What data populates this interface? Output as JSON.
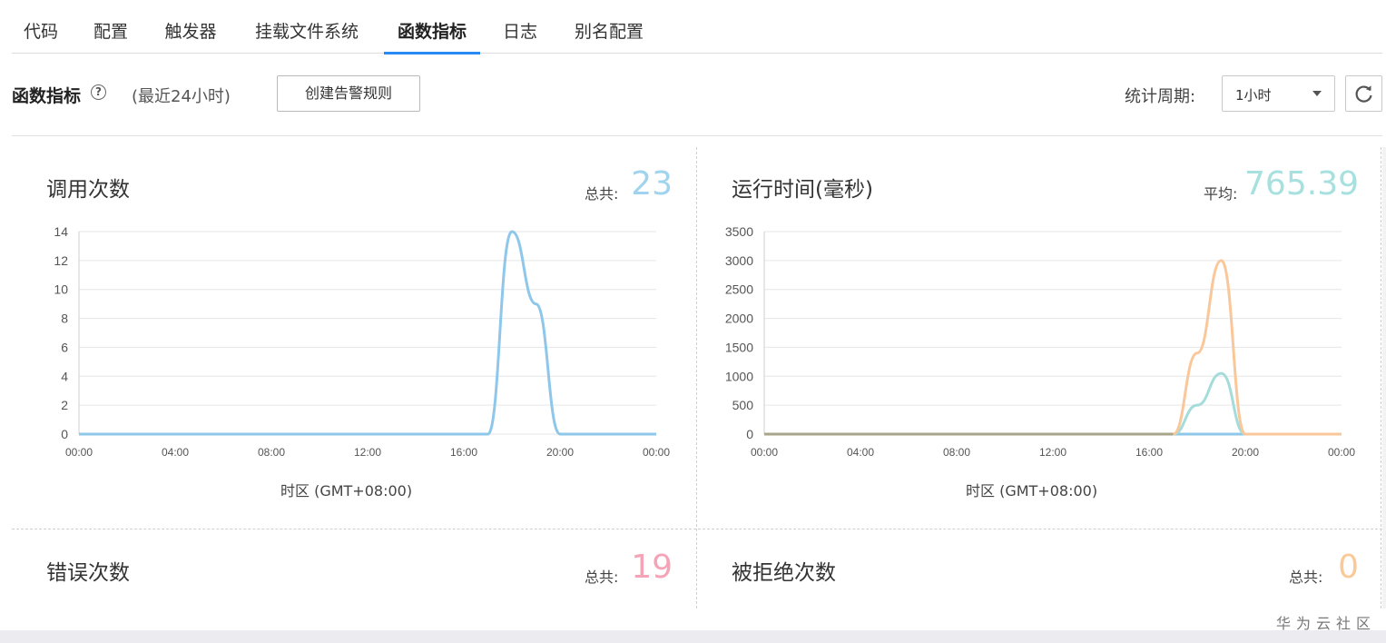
{
  "tabs": [
    {
      "label": "代码"
    },
    {
      "label": "配置"
    },
    {
      "label": "触发器"
    },
    {
      "label": "挂载文件系统"
    },
    {
      "label": "函数指标",
      "active": true
    },
    {
      "label": "日志"
    },
    {
      "label": "别名配置"
    }
  ],
  "header": {
    "title": "函数指标",
    "help_icon": "question-circle-icon",
    "subtitle": "(最近24小时)",
    "create_alarm_label": "创建告警规则",
    "period_label": "统计周期:",
    "period_value": "1小时",
    "refresh_icon": "refresh-icon"
  },
  "panels": {
    "invocations": {
      "title": "调用次数",
      "stat_label": "总共:",
      "stat_value": "23",
      "stat_color": "#9fd3ee"
    },
    "duration": {
      "title": "运行时间(毫秒)",
      "stat_label": "平均:",
      "stat_value": "765.39",
      "stat_color": "#a6e0df"
    },
    "errors": {
      "title": "错误次数",
      "stat_label": "总共:",
      "stat_value": "19",
      "stat_color": "#f5a4b8"
    },
    "throttles": {
      "title": "被拒绝次数",
      "stat_label": "总共:",
      "stat_value": "0",
      "stat_color": "#f9ca98"
    }
  },
  "timezone_label": "时区 (GMT+08:00)",
  "watermark": "华为云社区",
  "chart_data": [
    {
      "type": "line",
      "ylim": [
        0,
        14
      ],
      "yticks": [
        "14",
        "12",
        "10",
        "8",
        "6",
        "4",
        "2",
        "0"
      ],
      "xticks": [
        "00:00",
        "04:00",
        "08:00",
        "12:00",
        "16:00",
        "20:00",
        "00:00"
      ],
      "xlabel": "时区 (GMT+08:00)",
      "grid": true,
      "series": [
        {
          "color": "#8ec7ea",
          "x": [
            0,
            1,
            2,
            3,
            4,
            5,
            6,
            7,
            8,
            9,
            10,
            11,
            12,
            13,
            14,
            15,
            16,
            17,
            18,
            19,
            20,
            21,
            22,
            23,
            24
          ],
          "values": [
            0,
            0,
            0,
            0,
            0,
            0,
            0,
            0,
            0,
            0,
            0,
            0,
            0,
            0,
            0,
            0,
            0,
            0,
            14,
            9,
            0,
            0,
            0,
            0,
            0
          ]
        }
      ]
    },
    {
      "type": "line",
      "ylim": [
        0,
        3500
      ],
      "yticks": [
        "3500",
        "3000",
        "2500",
        "2000",
        "1500",
        "1000",
        "500",
        "0"
      ],
      "xticks": [
        "00:00",
        "04:00",
        "08:00",
        "12:00",
        "16:00",
        "20:00",
        "00:00"
      ],
      "xlabel": "时区 (GMT+08:00)",
      "grid": true,
      "series": [
        {
          "color": "#8ec7ea",
          "x": [
            0,
            24
          ],
          "values": [
            0,
            0
          ]
        },
        {
          "color": "#a3dcda",
          "x": [
            0,
            1,
            2,
            3,
            4,
            5,
            6,
            7,
            8,
            9,
            10,
            11,
            12,
            13,
            14,
            15,
            16,
            17,
            18,
            19,
            20,
            21,
            22,
            23,
            24
          ],
          "values": [
            0,
            0,
            0,
            0,
            0,
            0,
            0,
            0,
            0,
            0,
            0,
            0,
            0,
            0,
            0,
            0,
            0,
            0,
            500,
            1050,
            0,
            0,
            0,
            0,
            0
          ]
        },
        {
          "color": "#f9c79a",
          "x": [
            0,
            1,
            2,
            3,
            4,
            5,
            6,
            7,
            8,
            9,
            10,
            11,
            12,
            13,
            14,
            15,
            16,
            17,
            18,
            19,
            20,
            21,
            22,
            23,
            24
          ],
          "values": [
            0,
            0,
            0,
            0,
            0,
            0,
            0,
            0,
            0,
            0,
            0,
            0,
            0,
            0,
            0,
            0,
            0,
            0,
            1400,
            3000,
            0,
            0,
            0,
            0,
            0
          ]
        },
        {
          "color": "#a8a58b",
          "x": [
            0,
            17
          ],
          "values": [
            0,
            0
          ]
        }
      ]
    }
  ]
}
